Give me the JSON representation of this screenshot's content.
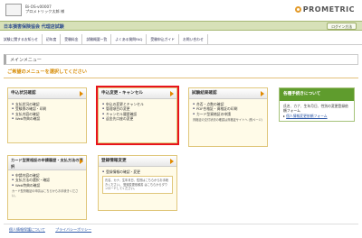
{
  "header": {
    "user_line1": "Bi-OS-v00007",
    "user_line2": "プロメトリック太郎 様",
    "brand": "PROMETRIC",
    "org_name": "日本損害保険協会 代理店試験",
    "help_button": "ログイン方法"
  },
  "nav": {
    "items": [
      "試験に関するお知らせ",
      "初年度",
      "受験料金",
      "試験概要一覧",
      "よくある質問FAQ",
      "受験申込ガイド",
      "お問い合わせ"
    ]
  },
  "menu": {
    "title": "メインメニュー",
    "instruction": "ご希望のメニューを選択してください"
  },
  "cards": {
    "status": {
      "title": "申込状況確認",
      "items": [
        "支払状況の確認",
        "受験票の確認・印刷",
        "支払内容の確認",
        "Web特典の確認"
      ]
    },
    "change": {
      "title": "申込変更・キャンセル",
      "items": [
        "申込の変更とキャンセル",
        "管理項目の変更",
        "キャンセル履歴確認",
        "返金先口座の変更"
      ]
    },
    "results": {
      "title": "試験結果確認",
      "items": [
        "合否・点数の確認",
        "PDF合格証・資格証の印刷",
        "カード型資格証の申請"
      ],
      "note": "資格証の交付状況の確認は資格証サイトへ (別ページ)"
    },
    "card_payment": {
      "title": "カード型資格証の申請履歴・支払方法の選択",
      "items": [
        "申請内容の確認",
        "支払方法の選択・確認",
        "Web特典の確認"
      ],
      "note": "カード型資格証の申請はこちらからお手続きください。"
    },
    "registration": {
      "title": "登録情報変更",
      "items": [
        "登録情報の確認・変更"
      ],
      "note": "氏名、カナ、生年月日、性別はこちらからお手続きください。 登録変更依頼書 はこちらからダウンロードしてください。"
    },
    "personal": {
      "title": "各種手続きについて",
      "body": "氏名、カナ、生年月日、性別の変更登録依頼フォーム",
      "link": "個人情報変更依頼フォーム"
    }
  },
  "footer": {
    "links": [
      "個人情報保護について",
      "プライバシーポリシー"
    ]
  }
}
